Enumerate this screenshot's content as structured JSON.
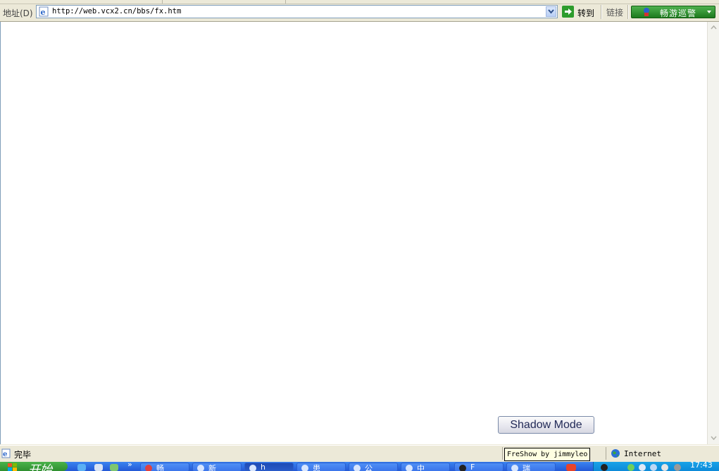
{
  "address_bar": {
    "label": "地址(D)",
    "url": "http://web.vcx2.cn/bbs/fx.htm",
    "go_label": "转到",
    "links_label": "链接",
    "extension_label": "畅游巡警"
  },
  "content": {
    "shadow_button_label": "Shadow Mode"
  },
  "status_bar": {
    "status_text": "完毕",
    "tooltip_text": "FreShow by jimmyleo",
    "zone_text": "Internet"
  },
  "taskbar": {
    "start_label": "开始",
    "quick_launch_more": "»",
    "tasks": [
      {
        "label": "畅",
        "active": false
      },
      {
        "label": "新",
        "active": false
      },
      {
        "label": "h",
        "active": true
      },
      {
        "label": "患",
        "active": false
      },
      {
        "label": "公",
        "active": false
      },
      {
        "label": "中",
        "active": false
      },
      {
        "label": "F",
        "active": false
      },
      {
        "label": "瑞",
        "active": false
      }
    ],
    "clock": "17:43"
  },
  "colors": {
    "chrome": "#ece9d8",
    "taskbar": "#245edb",
    "start_green": "#3c9c3c",
    "tray_blue": "#0f8ed8"
  }
}
